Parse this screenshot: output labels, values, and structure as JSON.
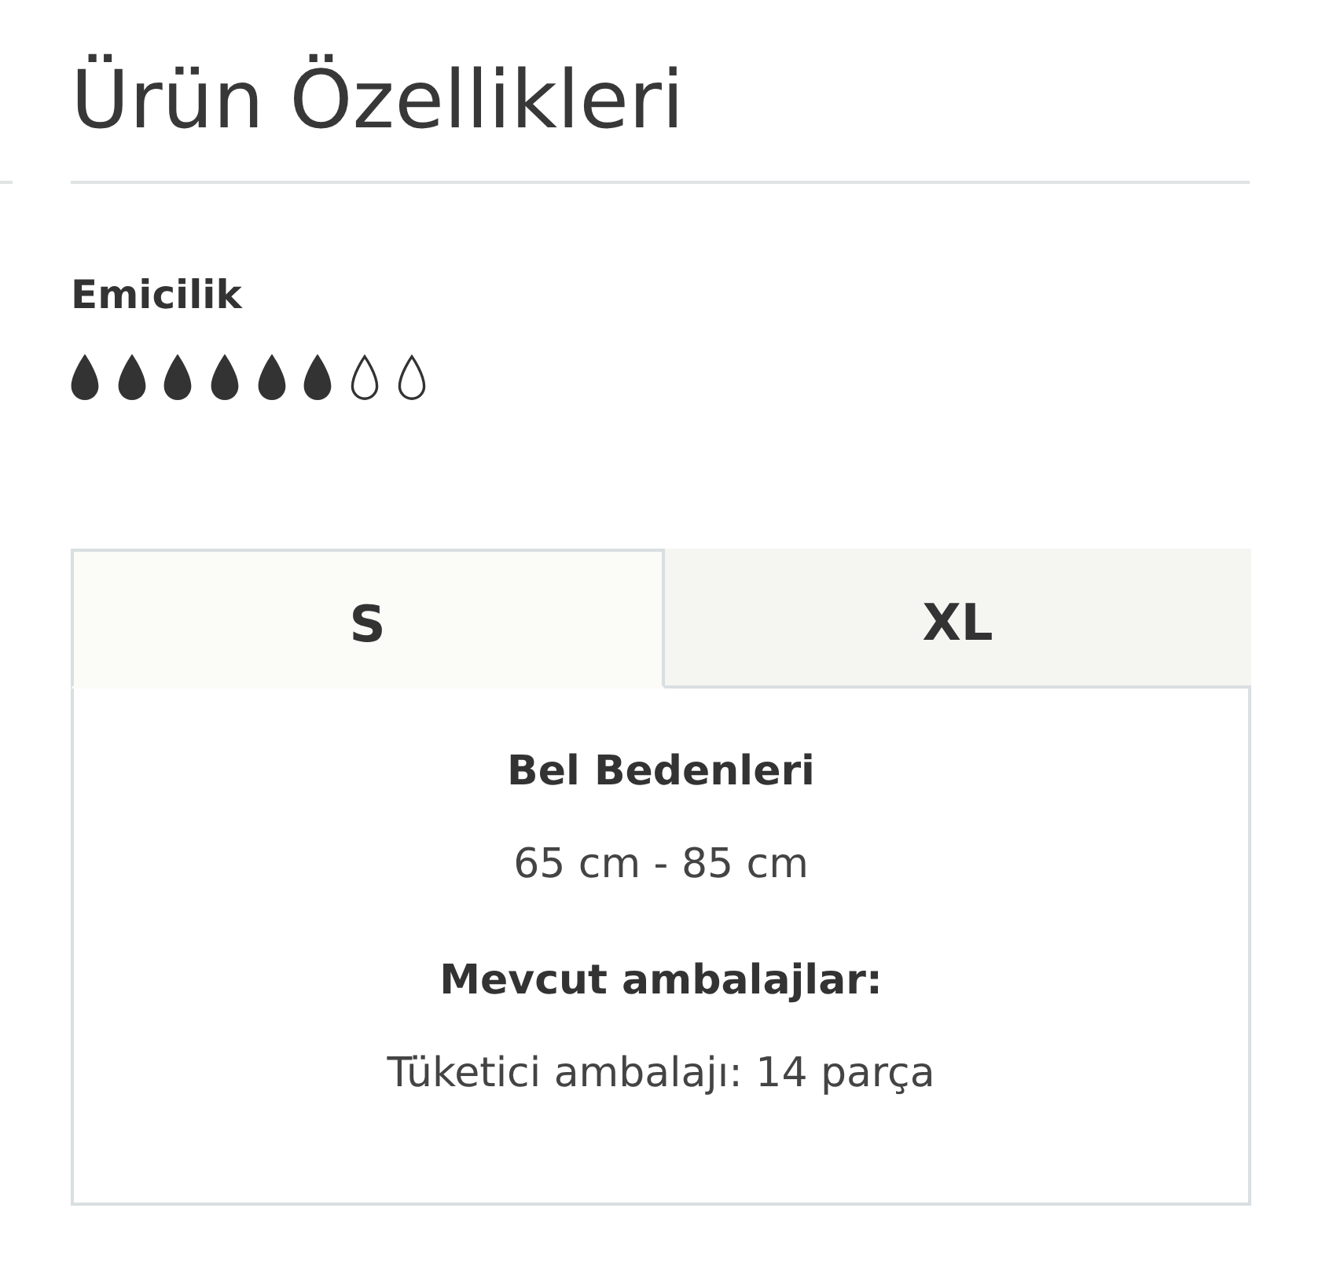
{
  "title": "Ürün Özellikleri",
  "absorbency": {
    "label": "Emicilik",
    "stars": 6
  },
  "tabs": [
    {
      "label": "S",
      "selected": true
    },
    {
      "label": "XL",
      "selected": false
    }
  ],
  "panel": {
    "sections": [
      {
        "heading": "Bel Bedenleri",
        "value": "65 cm - 85 cm"
      },
      {
        "heading": "Mevcut ambalajlar:",
        "value": "Tüketici ambalajı: 14 parça"
      }
    ]
  }
}
